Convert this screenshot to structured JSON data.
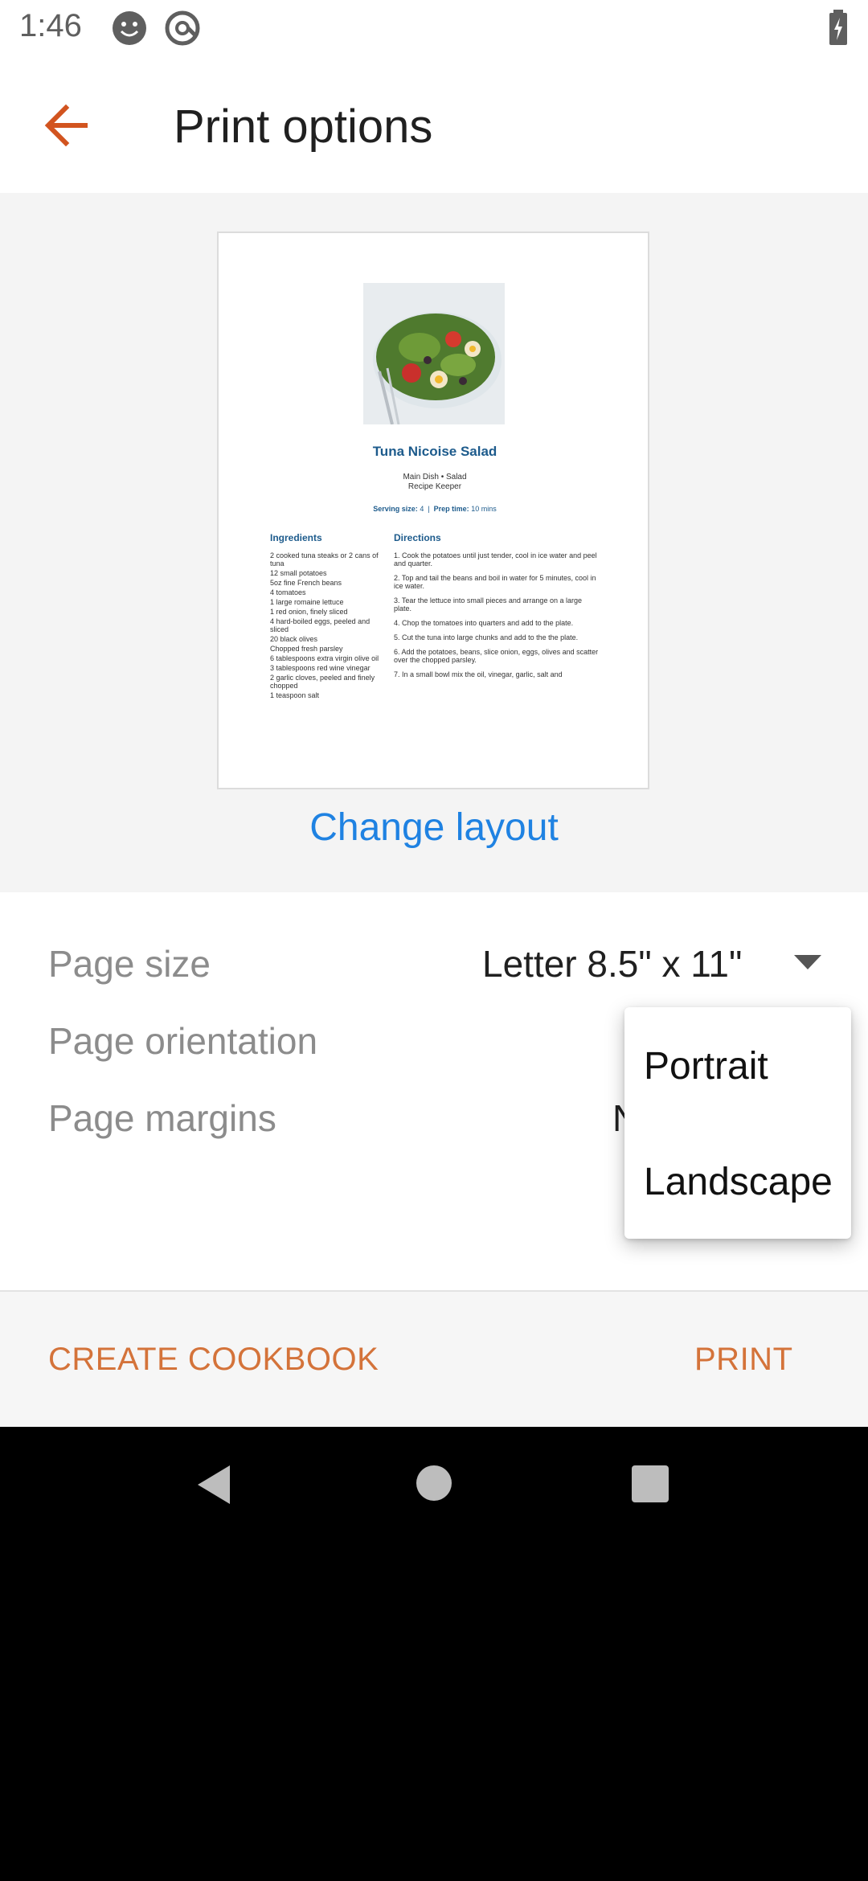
{
  "status_bar": {
    "time": "1:46"
  },
  "app_bar": {
    "title": "Print options"
  },
  "preview": {
    "recipe_title": "Tuna Nicoise Salad",
    "subtitle_line1": "Main Dish • Salad",
    "subtitle_line2": "Recipe Keeper",
    "serving_label": "Serving size:",
    "serving_value": "4",
    "prep_label": "Prep time:",
    "prep_value": "10 mins",
    "ingredients_heading": "Ingredients",
    "directions_heading": "Directions",
    "ingredients": [
      "2 cooked tuna steaks or 2 cans of tuna",
      "12 small potatoes",
      "5oz fine French beans",
      "4 tomatoes",
      "1 large romaine lettuce",
      "1 red onion, finely sliced",
      "4 hard-boiled eggs, peeled and sliced",
      "20 black olives",
      "Chopped fresh parsley",
      "6 tablespoons extra virgin olive oil",
      "3 tablespoons red wine vinegar",
      "2 garlic cloves, peeled and finely chopped",
      "1 teaspoon salt"
    ],
    "directions": [
      "1. Cook the potatoes until just tender, cool in ice water and peel and quarter.",
      "2. Top and tail the beans and boil in water for 5 minutes, cool in ice water.",
      "3. Tear the lettuce into small pieces and arrange on a large plate.",
      "4. Chop the tomatoes into quarters and add to the plate.",
      "5. Cut the tuna into large chunks and add to the the plate.",
      "6. Add the potatoes, beans, slice onion, eggs, olives and scatter over the chopped parsley.",
      "7. In a small bowl mix the oil, vinegar, garlic, salt and"
    ],
    "change_layout": "Change layout"
  },
  "settings": {
    "page_size_label": "Page size",
    "page_size_value": "Letter 8.5\" x 11\"",
    "page_orientation_label": "Page orientation",
    "page_margins_label": "Page margins",
    "page_margins_value_partial": "N"
  },
  "orientation_menu": {
    "options": [
      "Portrait",
      "Landscape"
    ]
  },
  "actions": {
    "create_cookbook": "CREATE COOKBOOK",
    "print": "PRINT"
  },
  "colors": {
    "accent": "#d4733a",
    "back_arrow": "#d2541f",
    "link": "#1f82e2",
    "recipe_blue": "#1d5b8c"
  },
  "icons": {
    "status": [
      "face-icon",
      "at-sync-icon",
      "battery-charging-icon"
    ],
    "app_bar": "back-arrow-icon",
    "dropdown": "dropdown-triangle-icon",
    "nav": [
      "nav-back-icon",
      "nav-home-icon",
      "nav-recents-icon"
    ]
  }
}
